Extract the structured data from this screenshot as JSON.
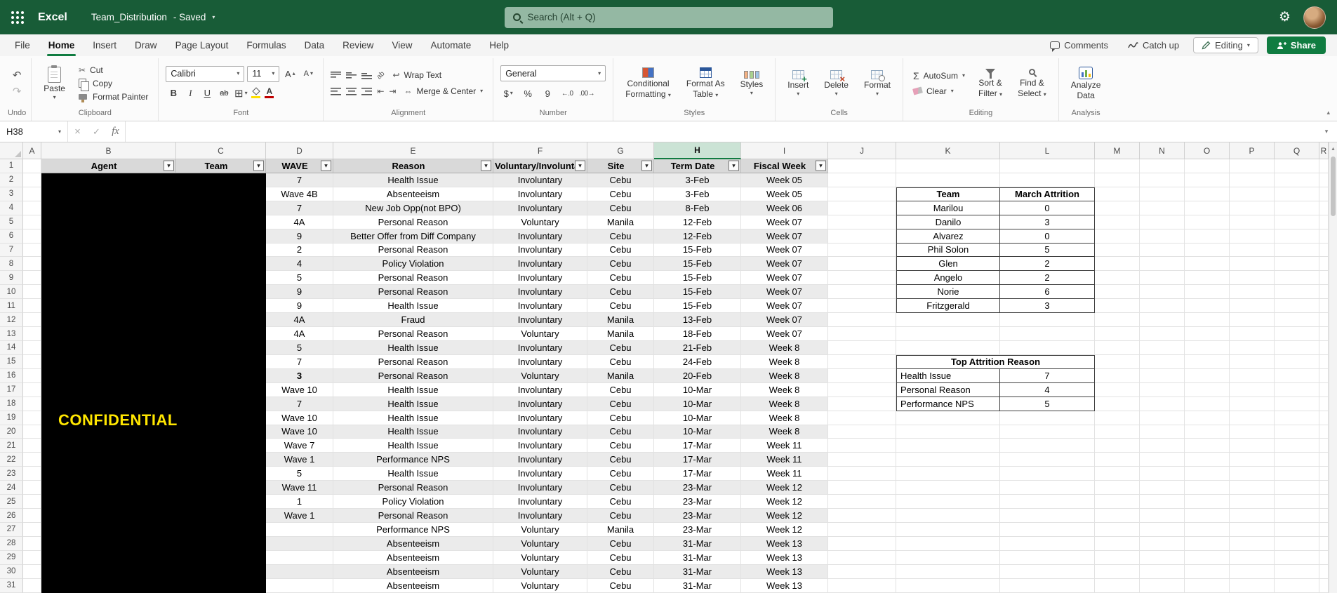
{
  "colors": {
    "topbar_green": "#185C37",
    "accent_green": "#107C41",
    "confidential_text": "#FFE600",
    "confidential_bg": "#000000",
    "selected_column_header_bg": "#CBE3D5",
    "table_header_bg": "#D9D9D9",
    "banding_bg": "#EBEBEB"
  },
  "icons": {
    "undo": "↶",
    "redo": "↷",
    "cut": "✂",
    "sigma": "Σ",
    "chevron_down": "▾",
    "chevron_up": "▴",
    "bold": "B",
    "italic": "I",
    "underline": "U",
    "strike": "ab",
    "font_letter": "A",
    "borders": "⊞",
    "wrap": "↩",
    "merge": "⇔",
    "dollar": "$",
    "percent": "%",
    "comma": "9",
    "add_decimal": "←.0",
    "remove_decimal": ".00→",
    "indent_left": "⇤",
    "indent_right": "⇥",
    "orientation": "ab",
    "gear": "⚙",
    "cancel": "×",
    "check": "✓",
    "filter": "▾"
  },
  "topbar": {
    "app_name": "Excel",
    "doc_title": "Team_Distribution",
    "save_status": "- Saved",
    "search_placeholder": "Search (Alt + Q)"
  },
  "menu": {
    "tabs": [
      "File",
      "Home",
      "Insert",
      "Draw",
      "Page Layout",
      "Formulas",
      "Data",
      "Review",
      "View",
      "Automate",
      "Help"
    ],
    "active_tab": "Home",
    "comments": "Comments",
    "catch_up": "Catch up",
    "editing": "Editing",
    "share": "Share"
  },
  "ribbon": {
    "groups": [
      "Undo",
      "Clipboard",
      "Font",
      "Alignment",
      "Number",
      "Styles",
      "Cells",
      "Editing",
      "Analysis"
    ],
    "paste": "Paste",
    "cut": "Cut",
    "copy": "Copy",
    "format_painter": "Format Painter",
    "font_name": "Calibri",
    "font_size": "11",
    "wrap_text": "Wrap Text",
    "merge_center": "Merge & Center",
    "number_format": "General",
    "conditional_line1": "Conditional",
    "conditional_line2": "Formatting",
    "format_table_line1": "Format As",
    "format_table_line2": "Table",
    "styles": "Styles",
    "insert": "Insert",
    "delete": "Delete",
    "format": "Format",
    "autosum": "AutoSum",
    "clear": "Clear",
    "sort_line1": "Sort &",
    "sort_line2": "Filter",
    "find_line1": "Find &",
    "find_line2": "Select",
    "analyze_line1": "Analyze",
    "analyze_line2": "Data"
  },
  "formula_bar": {
    "name_box": "H38",
    "fx": "fx"
  },
  "sheet": {
    "columns": [
      "A",
      "B",
      "C",
      "D",
      "E",
      "F",
      "G",
      "H",
      "I",
      "J",
      "K",
      "L",
      "M",
      "N",
      "O",
      "P",
      "Q",
      "R"
    ],
    "selected_column": "H",
    "table_headers": [
      "Agent",
      "Team",
      "WAVE",
      "Reason",
      "Voluntary/Involunta",
      "Site",
      "Term Date",
      "Fiscal Week"
    ],
    "confidential_label": "CONFIDENTIAL",
    "rows": [
      {
        "wave": "7",
        "reason": "Health Issue",
        "type": "Involuntary",
        "site": "Cebu",
        "term_date": "3-Feb",
        "fiscal_week": "Week 05"
      },
      {
        "wave": "Wave 4B",
        "reason": "Absenteeism",
        "type": "Involuntary",
        "site": "Cebu",
        "term_date": "3-Feb",
        "fiscal_week": "Week 05"
      },
      {
        "wave": "7",
        "reason": "New Job Opp(not BPO)",
        "type": "Involuntary",
        "site": "Cebu",
        "term_date": "8-Feb",
        "fiscal_week": "Week 06"
      },
      {
        "wave": "4A",
        "reason": "Personal Reason",
        "type": "Voluntary",
        "site": "Manila",
        "term_date": "12-Feb",
        "fiscal_week": "Week 07"
      },
      {
        "wave": "9",
        "reason": "Better Offer from Diff Company",
        "type": "Involuntary",
        "site": "Cebu",
        "term_date": "12-Feb",
        "fiscal_week": "Week 07"
      },
      {
        "wave": "2",
        "reason": "Personal Reason",
        "type": "Involuntary",
        "site": "Cebu",
        "term_date": "15-Feb",
        "fiscal_week": "Week 07"
      },
      {
        "wave": "4",
        "reason": "Policy Violation",
        "type": "Involuntary",
        "site": "Cebu",
        "term_date": "15-Feb",
        "fiscal_week": "Week 07"
      },
      {
        "wave": "5",
        "reason": "Personal Reason",
        "type": "Involuntary",
        "site": "Cebu",
        "term_date": "15-Feb",
        "fiscal_week": "Week 07"
      },
      {
        "wave": "9",
        "reason": "Personal Reason",
        "type": "Involuntary",
        "site": "Cebu",
        "term_date": "15-Feb",
        "fiscal_week": "Week 07"
      },
      {
        "wave": "9",
        "reason": "Health Issue",
        "type": "Involuntary",
        "site": "Cebu",
        "term_date": "15-Feb",
        "fiscal_week": "Week 07"
      },
      {
        "wave": "4A",
        "reason": "Fraud",
        "type": "Involuntary",
        "site": "Manila",
        "term_date": "13-Feb",
        "fiscal_week": "Week 07"
      },
      {
        "wave": "4A",
        "reason": "Personal Reason",
        "type": "Voluntary",
        "site": "Manila",
        "term_date": "18-Feb",
        "fiscal_week": "Week 07"
      },
      {
        "wave": "5",
        "reason": "Health Issue",
        "type": "Involuntary",
        "site": "Cebu",
        "term_date": "21-Feb",
        "fiscal_week": "Week 8"
      },
      {
        "wave": "7",
        "reason": "Personal Reason",
        "type": "Involuntary",
        "site": "Cebu",
        "term_date": "24-Feb",
        "fiscal_week": "Week 8"
      },
      {
        "wave": "3",
        "wave_bold": true,
        "reason": "Personal Reason",
        "type": "Voluntary",
        "site": "Manila",
        "term_date": "20-Feb",
        "fiscal_week": "Week 8"
      },
      {
        "wave": "Wave 10",
        "reason": "Health Issue",
        "type": "Involuntary",
        "site": "Cebu",
        "term_date": "10-Mar",
        "fiscal_week": "Week 8"
      },
      {
        "wave": "7",
        "reason": "Health Issue",
        "type": "Involuntary",
        "site": "Cebu",
        "term_date": "10-Mar",
        "fiscal_week": "Week 8"
      },
      {
        "wave": "Wave 10",
        "reason": "Health Issue",
        "type": "Involuntary",
        "site": "Cebu",
        "term_date": "10-Mar",
        "fiscal_week": "Week 8"
      },
      {
        "wave": "Wave 10",
        "reason": "Health Issue",
        "type": "Involuntary",
        "site": "Cebu",
        "term_date": "10-Mar",
        "fiscal_week": "Week 8"
      },
      {
        "wave": "Wave 7",
        "reason": "Health Issue",
        "type": "Involuntary",
        "site": "Cebu",
        "term_date": "17-Mar",
        "fiscal_week": "Week 11"
      },
      {
        "wave": "Wave 1",
        "reason": "Performance NPS",
        "type": "Involuntary",
        "site": "Cebu",
        "term_date": "17-Mar",
        "fiscal_week": "Week 11"
      },
      {
        "wave": "5",
        "reason": "Health Issue",
        "type": "Involuntary",
        "site": "Cebu",
        "term_date": "17-Mar",
        "fiscal_week": "Week 11"
      },
      {
        "wave": "Wave 11",
        "reason": "Personal Reason",
        "type": "Involuntary",
        "site": "Cebu",
        "term_date": "23-Mar",
        "fiscal_week": "Week 12"
      },
      {
        "wave": "1",
        "reason": "Policy Violation",
        "type": "Involuntary",
        "site": "Cebu",
        "term_date": "23-Mar",
        "fiscal_week": "Week 12"
      },
      {
        "wave": "Wave 1",
        "reason": "Personal Reason",
        "type": "Involuntary",
        "site": "Cebu",
        "term_date": "23-Mar",
        "fiscal_week": "Week 12"
      },
      {
        "wave": "",
        "reason": "Performance NPS",
        "type": "Voluntary",
        "site": "Manila",
        "term_date": "23-Mar",
        "fiscal_week": "Week 12"
      },
      {
        "wave": "",
        "reason": "Absenteeism",
        "type": "Voluntary",
        "site": "Cebu",
        "term_date": "31-Mar",
        "fiscal_week": "Week 13"
      },
      {
        "wave": "",
        "reason": "Absenteeism",
        "type": "Voluntary",
        "site": "Cebu",
        "term_date": "31-Mar",
        "fiscal_week": "Week 13"
      },
      {
        "wave": "",
        "reason": "Absenteeism",
        "type": "Voluntary",
        "site": "Cebu",
        "term_date": "31-Mar",
        "fiscal_week": "Week 13"
      },
      {
        "wave": "",
        "reason": "Absenteeism",
        "type": "Voluntary",
        "site": "Cebu",
        "term_date": "31-Mar",
        "fiscal_week": "Week 13"
      }
    ],
    "team_table": {
      "headers": [
        "Team",
        "March Attrition"
      ],
      "rows": [
        [
          "Marilou",
          "0"
        ],
        [
          "Danilo",
          "3"
        ],
        [
          "Alvarez",
          "0"
        ],
        [
          "Phil Solon",
          "5"
        ],
        [
          "Glen",
          "2"
        ],
        [
          "Angelo",
          "2"
        ],
        [
          "Norie",
          "6"
        ],
        [
          "Fritzgerald",
          "3"
        ]
      ]
    },
    "attrition_table": {
      "title": "Top Attrition Reason",
      "rows": [
        [
          "Health Issue",
          "7"
        ],
        [
          "Personal Reason",
          "4"
        ],
        [
          "Performance NPS",
          "5"
        ]
      ]
    }
  }
}
